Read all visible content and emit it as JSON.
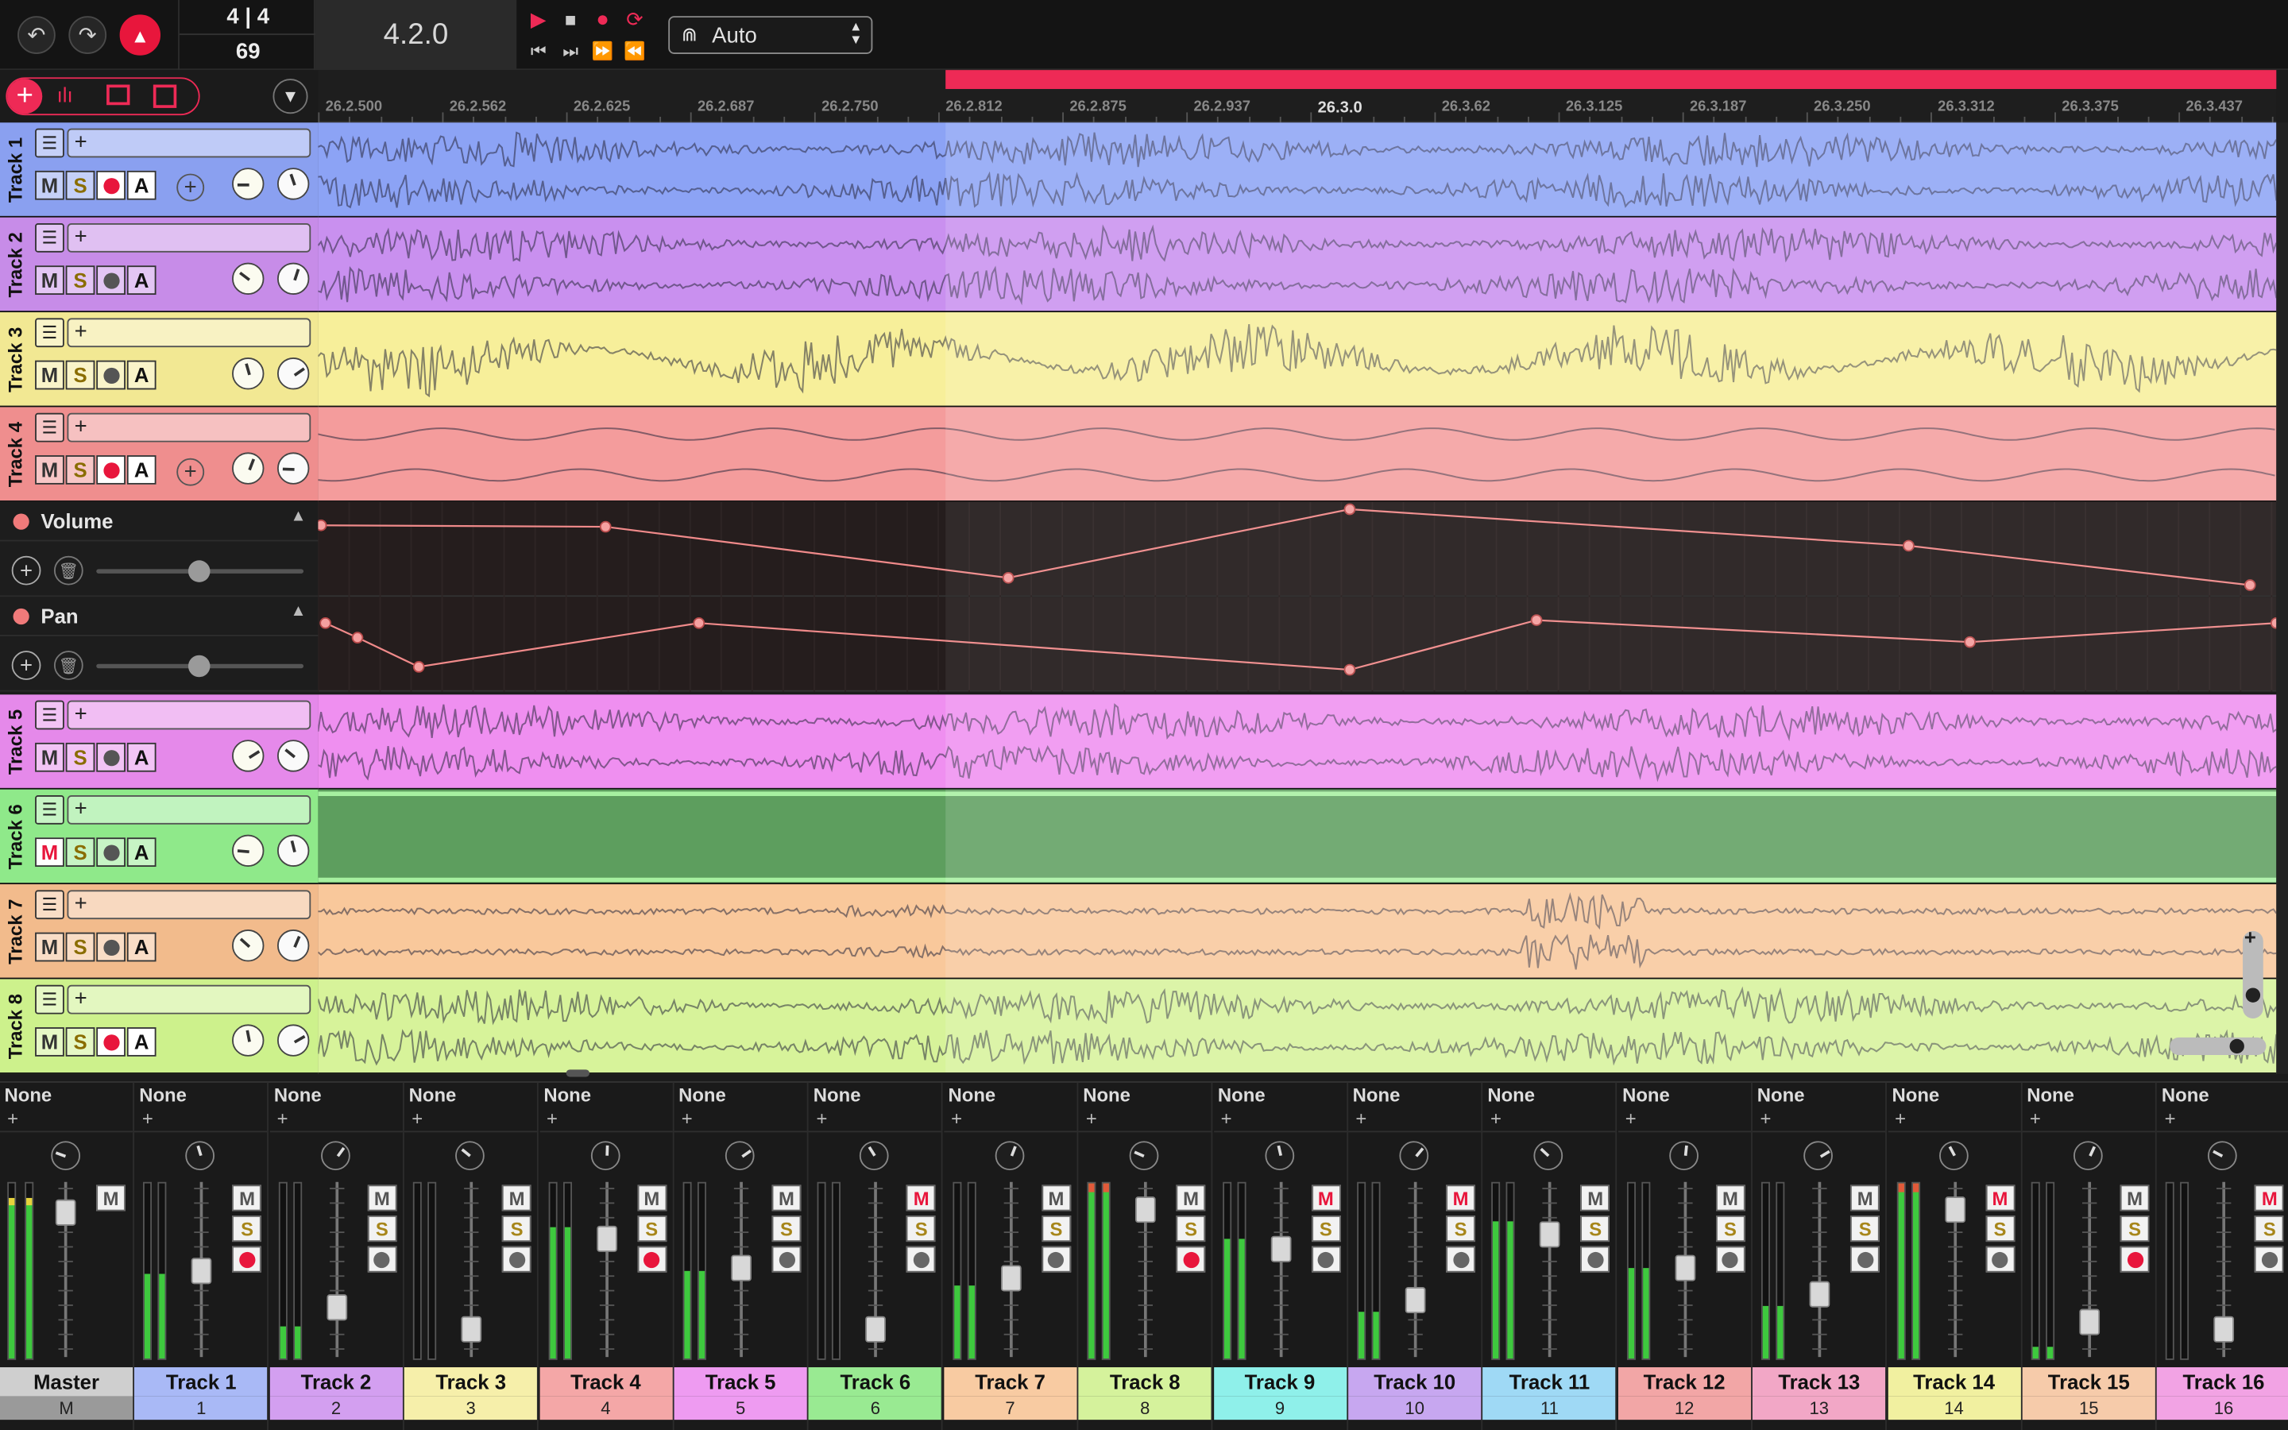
{
  "toolbar": {
    "time_sig": "4 | 4",
    "tempo": "69",
    "position": "4.2.0",
    "snap_value": "Auto"
  },
  "ruler": {
    "ticks": [
      "26.2.500",
      "26.2.562",
      "26.2.625",
      "26.2.687",
      "26.2.750",
      "26.2.812",
      "26.2.875",
      "26.2.937",
      "26.3.0",
      "26.3.62",
      "26.3.125",
      "26.3.187",
      "26.3.250",
      "26.3.312",
      "26.3.375",
      "26.3.437"
    ]
  },
  "tracks": [
    {
      "name": "Track 1",
      "color": "#8ca3f5",
      "head": "#8aa0f0",
      "ins": "+",
      "m": "M",
      "s": "S",
      "a": "A",
      "rec": true
    },
    {
      "name": "Track 2",
      "color": "#c990ef",
      "head": "#c78ce8",
      "ins": "+",
      "m": "M",
      "s": "S",
      "a": "A",
      "rec": false
    },
    {
      "name": "Track 3",
      "color": "#f7ef9a",
      "head": "#f2e893",
      "ins": "+",
      "m": "M",
      "s": "S",
      "a": "A",
      "rec": false
    },
    {
      "name": "Track 4",
      "color": "#f49c9c",
      "head": "#ef8e8e",
      "ins": "+",
      "m": "M",
      "s": "S",
      "a": "A",
      "rec": true
    },
    {
      "name": "Track 5",
      "color": "#ef8ff0",
      "head": "#e589ea",
      "ins": "+",
      "m": "M",
      "s": "S",
      "a": "A",
      "rec": false
    },
    {
      "name": "Track 6",
      "color": "#5d9e5e",
      "head": "#8fe98a",
      "ins": "+",
      "m": "M",
      "s": "S",
      "a": "A",
      "rec": false
    },
    {
      "name": "Track 7",
      "color": "#f9c89b",
      "head": "#f2bb8c",
      "ins": "+",
      "m": "M",
      "s": "S",
      "a": "A",
      "rec": false
    },
    {
      "name": "Track 8",
      "color": "#d7f39a",
      "head": "#cdf18c",
      "ins": "+",
      "m": "M",
      "s": "S",
      "a": "A",
      "rec": true
    }
  ],
  "automation": {
    "volume_label": "Volume",
    "pan_label": "Pan"
  },
  "mixer": {
    "send_label": "None",
    "add": "+",
    "strips": [
      {
        "name": "Master",
        "num": "M",
        "color": "#cfcfcf",
        "level": 0.92,
        "fader": 0.9,
        "m": "M",
        "s": "",
        "rec": false
      },
      {
        "name": "Track 1",
        "num": "1",
        "color": "#a9b9f6",
        "level": 0.48,
        "fader": 0.5,
        "m": "M",
        "s": "S",
        "rec": true
      },
      {
        "name": "Track 2",
        "num": "2",
        "color": "#d39ff0",
        "level": 0.18,
        "fader": 0.25,
        "m": "M",
        "s": "S",
        "rec": false
      },
      {
        "name": "Track 3",
        "num": "3",
        "color": "#f6efaa",
        "level": 0.0,
        "fader": 0.1,
        "m": "M",
        "s": "S",
        "rec": false
      },
      {
        "name": "Track 4",
        "num": "4",
        "color": "#f4a7a7",
        "level": 0.75,
        "fader": 0.72,
        "m": "M",
        "s": "S",
        "rec": true
      },
      {
        "name": "Track 5",
        "num": "5",
        "color": "#ee9bf1",
        "level": 0.5,
        "fader": 0.52,
        "m": "M",
        "s": "S",
        "rec": false
      },
      {
        "name": "Track 6",
        "num": "6",
        "color": "#99ea92",
        "level": 0.0,
        "fader": 0.1,
        "m": "M",
        "s": "S",
        "rec": false
      },
      {
        "name": "Track 7",
        "num": "7",
        "color": "#f8cba2",
        "level": 0.42,
        "fader": 0.45,
        "m": "M",
        "s": "S",
        "rec": false
      },
      {
        "name": "Track 8",
        "num": "8",
        "color": "#d5f29c",
        "level": 1.0,
        "fader": 0.92,
        "m": "M",
        "s": "S",
        "rec": true
      },
      {
        "name": "Track 9",
        "num": "9",
        "color": "#8ff0ea",
        "level": 0.68,
        "fader": 0.65,
        "m": "M",
        "s": "S",
        "rec": false
      },
      {
        "name": "Track 10",
        "num": "10",
        "color": "#c7a7f0",
        "level": 0.27,
        "fader": 0.3,
        "m": "M",
        "s": "S",
        "rec": false
      },
      {
        "name": "Track 11",
        "num": "11",
        "color": "#9fd9f5",
        "level": 0.78,
        "fader": 0.75,
        "m": "M",
        "s": "S",
        "rec": false
      },
      {
        "name": "Track 12",
        "num": "12",
        "color": "#f2a6a6",
        "level": 0.52,
        "fader": 0.52,
        "m": "M",
        "s": "S",
        "rec": false
      },
      {
        "name": "Track 13",
        "num": "13",
        "color": "#f2a7c6",
        "level": 0.3,
        "fader": 0.34,
        "m": "M",
        "s": "S",
        "rec": false
      },
      {
        "name": "Track 14",
        "num": "14",
        "color": "#f1f0a0",
        "level": 1.0,
        "fader": 0.92,
        "m": "M",
        "s": "S",
        "rec": false
      },
      {
        "name": "Track 15",
        "num": "15",
        "color": "#f6cbaa",
        "level": 0.07,
        "fader": 0.15,
        "m": "M",
        "s": "S",
        "rec": true
      },
      {
        "name": "Track 16",
        "num": "16",
        "color": "#f2a3e4",
        "level": 0.0,
        "fader": 0.1,
        "m": "M",
        "s": "S",
        "rec": false
      }
    ]
  },
  "colors": {
    "accent": "#ee2a56",
    "meter": "#3ec93e",
    "mute_active": "#e8163c"
  }
}
